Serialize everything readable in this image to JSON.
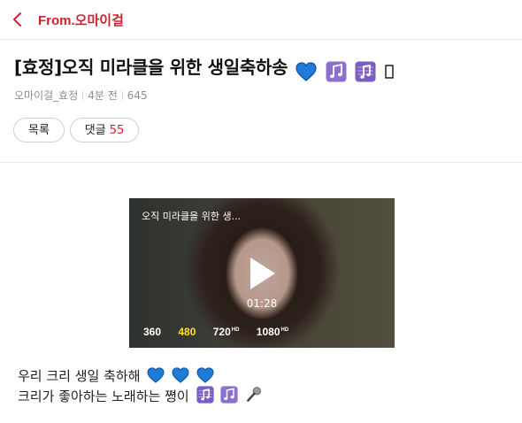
{
  "header": {
    "back_icon": "chevron-left-icon",
    "brand": "From.오마이걸"
  },
  "post": {
    "title": "[효정]오직 미라클을 위한 생일축하송",
    "title_icons": [
      "blue-heart-icon",
      "music-notes-icon",
      "musical-score-icon",
      "missing-glyph-icon"
    ],
    "author": "오마이걸_효정",
    "time": "4분 전",
    "views": "645"
  },
  "buttons": {
    "list": "목록",
    "comments": "댓글",
    "comment_count": "55"
  },
  "video": {
    "title": "오직 미라클을 위한 생...",
    "duration": "01:28",
    "play_icon": "play-icon",
    "qualities": [
      {
        "label": "360",
        "hd": ""
      },
      {
        "label": "480",
        "hd": ""
      },
      {
        "label": "720",
        "hd": "HD"
      },
      {
        "label": "1080",
        "hd": "HD"
      }
    ],
    "active_quality": "480"
  },
  "content": {
    "line1": "우리 크리 생일 축하해",
    "line1_icons": [
      "blue-heart-icon",
      "blue-heart-icon",
      "blue-heart-icon"
    ],
    "line2": "크리가 좋아하는 노래하는 쪙이",
    "line2_icons": [
      "musical-score-icon",
      "music-notes-icon",
      "microphone-icon"
    ]
  },
  "colors": {
    "accent": "#d0202f",
    "heart": "#1f7ad8",
    "music": "#7b5bc4",
    "quality_active": "#ffe21a"
  }
}
